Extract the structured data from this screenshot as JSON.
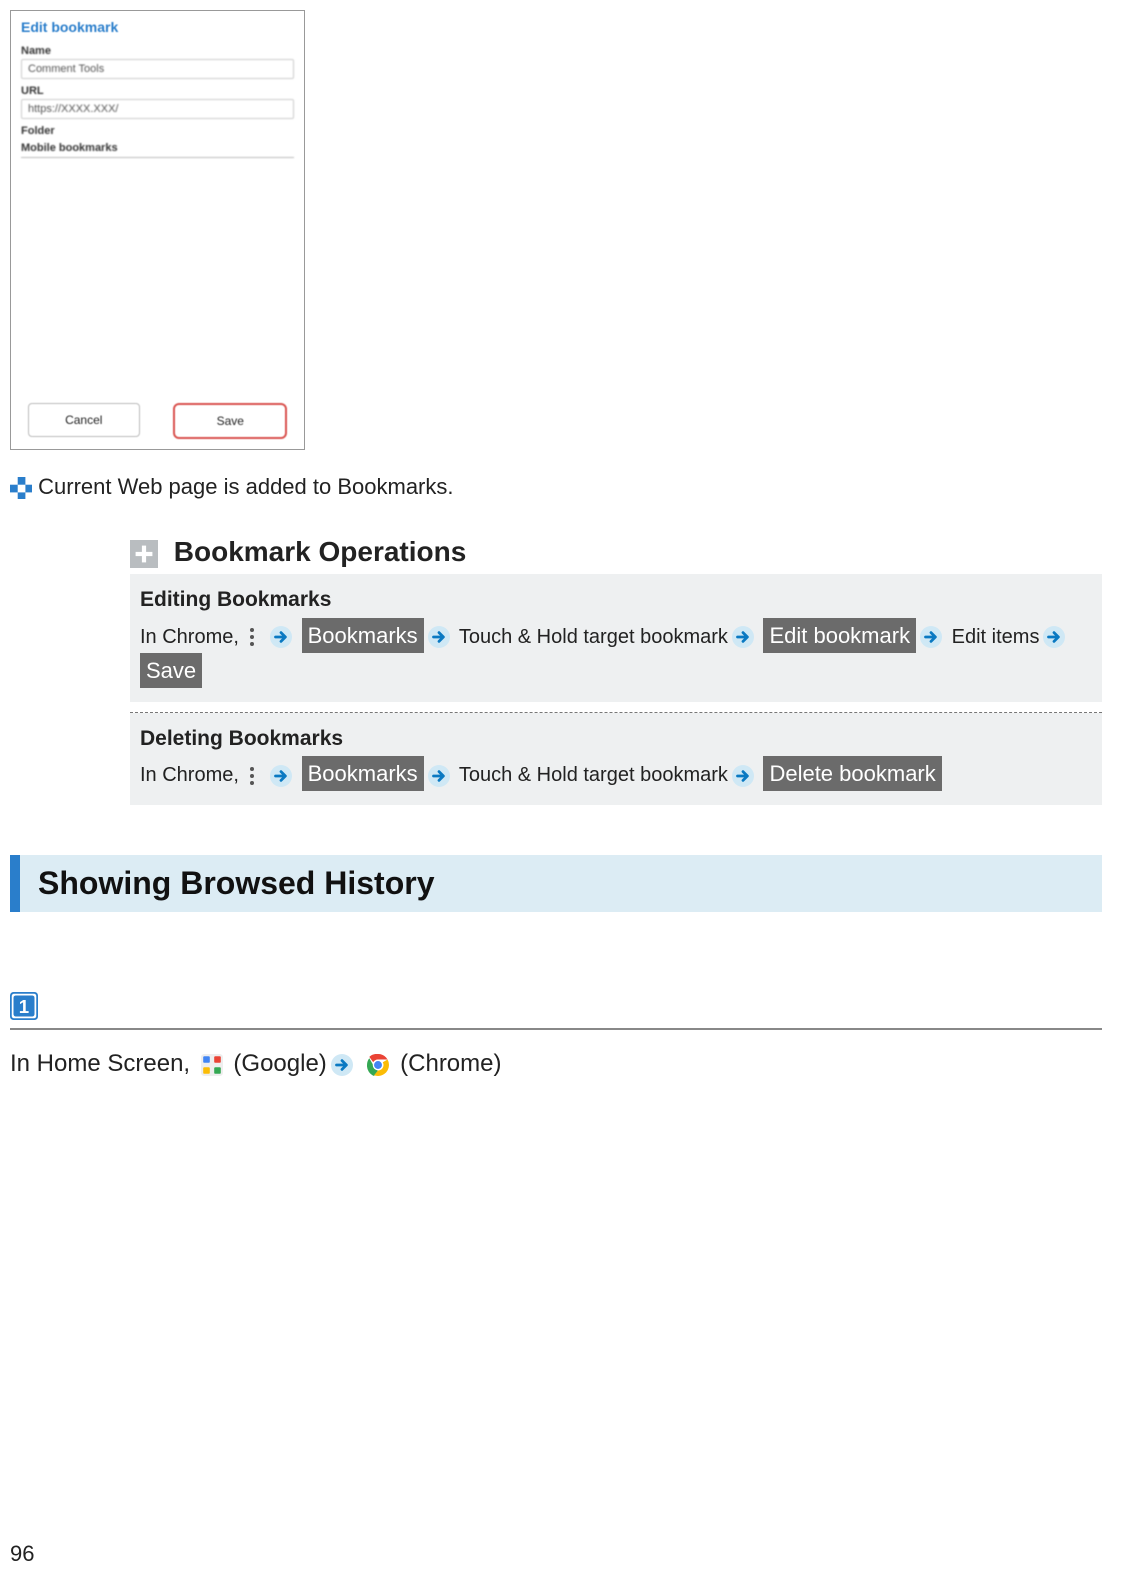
{
  "phone_shot": {
    "title": "Edit bookmark",
    "name_label": "Name",
    "name_value": "Comment Tools",
    "url_label": "URL",
    "url_value": "https://XXXX.XXX/",
    "folder_label": "Folder",
    "folder_value": "Mobile bookmarks",
    "cancel": "Cancel",
    "save": "Save"
  },
  "result_text": "Current Web page is added to Bookmarks.",
  "bookmark_ops": {
    "heading": "Bookmark Operations",
    "edit": {
      "subhead": "Editing Bookmarks",
      "line_prefix": "In Chrome, ",
      "chip_bookmarks": "Bookmarks",
      "txt_touch_hold": " Touch & Hold target bookmark",
      "chip_edit": "Edit bookmark",
      "txt_edit_items": "Edit items",
      "chip_save": "Save"
    },
    "del": {
      "subhead": "Deleting Bookmarks",
      "line_prefix": "In Chrome, ",
      "chip_bookmarks": "Bookmarks",
      "txt_touch_hold": " Touch & Hold target bookmark",
      "chip_delete": "Delete bookmark"
    }
  },
  "section_heading": "Showing Browsed History",
  "step1": {
    "number": "1",
    "prefix": "In Home Screen, ",
    "google": " (Google)",
    "chrome": " (Chrome)"
  },
  "page_number": "96"
}
